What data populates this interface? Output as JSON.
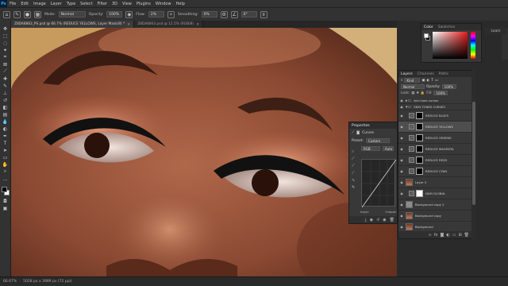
{
  "menubar": {
    "logo": "Ps",
    "items": [
      "File",
      "Edit",
      "Image",
      "Layer",
      "Type",
      "Select",
      "Filter",
      "3D",
      "View",
      "Plugins",
      "Window",
      "Help"
    ]
  },
  "options": {
    "mode_label": "Mode:",
    "mode_value": "Normal",
    "opacity_label": "Opacity:",
    "opacity_value": "100%",
    "flow_label": "Flow:",
    "flow_value": "2%",
    "smoothing_label": "Smoothing:",
    "smoothing_value": "0%",
    "angle_value": "0°"
  },
  "tabs": [
    {
      "label": "Z8DA8863_PS.psd @ 66.7% (REDUCE YELLOWS, Layer Mask/8) *",
      "active": true
    },
    {
      "label": "Z8DA8863.psd @ 12.5% (RGB/8)",
      "active": false
    }
  ],
  "status": {
    "zoom": "66.67%",
    "doc_size": "5028 px x 3989 px (72 ppi)"
  },
  "color_panel": {
    "tabs": [
      "Color",
      "Swatches"
    ],
    "learn_label": "Learn"
  },
  "layers_panel": {
    "tabs": [
      "Layers",
      "Channels",
      "Paths"
    ],
    "kind_label": "Kind",
    "blend_mode": "Normal",
    "opacity_label": "Opacity:",
    "opacity_value": "100%",
    "lock_label": "Lock:",
    "fill_label": "Fill:",
    "fill_value": "100%",
    "layers": [
      {
        "name": "skin tone curves",
        "type": "folder",
        "kind": "small"
      },
      {
        "name": "SKIN TONES CURVES",
        "type": "folder",
        "kind": "small"
      },
      {
        "name": "REDUCE BLUES",
        "type": "adjust",
        "mask": "black"
      },
      {
        "name": "REDUCE YELLOWS",
        "type": "adjust",
        "mask": "black",
        "selected": true
      },
      {
        "name": "REDUCE GREENS",
        "type": "adjust",
        "mask": "black"
      },
      {
        "name": "REDUCE MAGENTA",
        "type": "adjust",
        "mask": "black"
      },
      {
        "name": "REDUCE REDS",
        "type": "adjust",
        "mask": "black"
      },
      {
        "name": "REDUCE CYAN",
        "type": "adjust",
        "mask": "black"
      },
      {
        "name": "Layer 3",
        "type": "photo"
      },
      {
        "name": "DAM GLOBAL",
        "type": "adjust",
        "mask": "white"
      },
      {
        "name": "Background copy 2",
        "type": "gray"
      },
      {
        "name": "Background copy",
        "type": "photo"
      },
      {
        "name": "Background",
        "type": "photo"
      }
    ]
  },
  "properties": {
    "title": "Properties",
    "type_label": "Curves",
    "preset_label": "Preset:",
    "preset_value": "Custom",
    "channel_value": "RGB",
    "auto_label": "Auto",
    "input_label": "Input:",
    "output_label": "Output:"
  },
  "colors": {
    "app_bg": "#323232",
    "panel_bg": "#383838",
    "selected_row": "#4e4e4e",
    "ps_blue": "#31a8ff"
  }
}
